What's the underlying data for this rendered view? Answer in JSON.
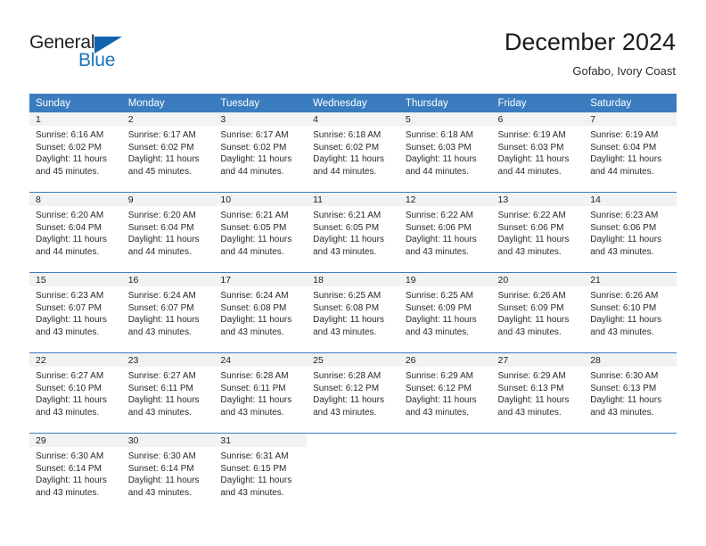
{
  "brand": {
    "name_part1": "General",
    "name_part2": "Blue",
    "triangle_icon": "triangle-icon",
    "color_dark": "#231f20",
    "color_blue": "#1b75bb"
  },
  "header": {
    "title": "December 2024",
    "subtitle": "Gofabo, Ivory Coast",
    "accent_color": "#3a7cbe",
    "daynum_band_color": "#f2f2f2"
  },
  "weekday_headers": [
    "Sunday",
    "Monday",
    "Tuesday",
    "Wednesday",
    "Thursday",
    "Friday",
    "Saturday"
  ],
  "weeks": [
    [
      {
        "day": "1",
        "sunrise": "Sunrise: 6:16 AM",
        "sunset": "Sunset: 6:02 PM",
        "daylight1": "Daylight: 11 hours",
        "daylight2": "and 45 minutes."
      },
      {
        "day": "2",
        "sunrise": "Sunrise: 6:17 AM",
        "sunset": "Sunset: 6:02 PM",
        "daylight1": "Daylight: 11 hours",
        "daylight2": "and 45 minutes."
      },
      {
        "day": "3",
        "sunrise": "Sunrise: 6:17 AM",
        "sunset": "Sunset: 6:02 PM",
        "daylight1": "Daylight: 11 hours",
        "daylight2": "and 44 minutes."
      },
      {
        "day": "4",
        "sunrise": "Sunrise: 6:18 AM",
        "sunset": "Sunset: 6:02 PM",
        "daylight1": "Daylight: 11 hours",
        "daylight2": "and 44 minutes."
      },
      {
        "day": "5",
        "sunrise": "Sunrise: 6:18 AM",
        "sunset": "Sunset: 6:03 PM",
        "daylight1": "Daylight: 11 hours",
        "daylight2": "and 44 minutes."
      },
      {
        "day": "6",
        "sunrise": "Sunrise: 6:19 AM",
        "sunset": "Sunset: 6:03 PM",
        "daylight1": "Daylight: 11 hours",
        "daylight2": "and 44 minutes."
      },
      {
        "day": "7",
        "sunrise": "Sunrise: 6:19 AM",
        "sunset": "Sunset: 6:04 PM",
        "daylight1": "Daylight: 11 hours",
        "daylight2": "and 44 minutes."
      }
    ],
    [
      {
        "day": "8",
        "sunrise": "Sunrise: 6:20 AM",
        "sunset": "Sunset: 6:04 PM",
        "daylight1": "Daylight: 11 hours",
        "daylight2": "and 44 minutes."
      },
      {
        "day": "9",
        "sunrise": "Sunrise: 6:20 AM",
        "sunset": "Sunset: 6:04 PM",
        "daylight1": "Daylight: 11 hours",
        "daylight2": "and 44 minutes."
      },
      {
        "day": "10",
        "sunrise": "Sunrise: 6:21 AM",
        "sunset": "Sunset: 6:05 PM",
        "daylight1": "Daylight: 11 hours",
        "daylight2": "and 44 minutes."
      },
      {
        "day": "11",
        "sunrise": "Sunrise: 6:21 AM",
        "sunset": "Sunset: 6:05 PM",
        "daylight1": "Daylight: 11 hours",
        "daylight2": "and 43 minutes."
      },
      {
        "day": "12",
        "sunrise": "Sunrise: 6:22 AM",
        "sunset": "Sunset: 6:06 PM",
        "daylight1": "Daylight: 11 hours",
        "daylight2": "and 43 minutes."
      },
      {
        "day": "13",
        "sunrise": "Sunrise: 6:22 AM",
        "sunset": "Sunset: 6:06 PM",
        "daylight1": "Daylight: 11 hours",
        "daylight2": "and 43 minutes."
      },
      {
        "day": "14",
        "sunrise": "Sunrise: 6:23 AM",
        "sunset": "Sunset: 6:06 PM",
        "daylight1": "Daylight: 11 hours",
        "daylight2": "and 43 minutes."
      }
    ],
    [
      {
        "day": "15",
        "sunrise": "Sunrise: 6:23 AM",
        "sunset": "Sunset: 6:07 PM",
        "daylight1": "Daylight: 11 hours",
        "daylight2": "and 43 minutes."
      },
      {
        "day": "16",
        "sunrise": "Sunrise: 6:24 AM",
        "sunset": "Sunset: 6:07 PM",
        "daylight1": "Daylight: 11 hours",
        "daylight2": "and 43 minutes."
      },
      {
        "day": "17",
        "sunrise": "Sunrise: 6:24 AM",
        "sunset": "Sunset: 6:08 PM",
        "daylight1": "Daylight: 11 hours",
        "daylight2": "and 43 minutes."
      },
      {
        "day": "18",
        "sunrise": "Sunrise: 6:25 AM",
        "sunset": "Sunset: 6:08 PM",
        "daylight1": "Daylight: 11 hours",
        "daylight2": "and 43 minutes."
      },
      {
        "day": "19",
        "sunrise": "Sunrise: 6:25 AM",
        "sunset": "Sunset: 6:09 PM",
        "daylight1": "Daylight: 11 hours",
        "daylight2": "and 43 minutes."
      },
      {
        "day": "20",
        "sunrise": "Sunrise: 6:26 AM",
        "sunset": "Sunset: 6:09 PM",
        "daylight1": "Daylight: 11 hours",
        "daylight2": "and 43 minutes."
      },
      {
        "day": "21",
        "sunrise": "Sunrise: 6:26 AM",
        "sunset": "Sunset: 6:10 PM",
        "daylight1": "Daylight: 11 hours",
        "daylight2": "and 43 minutes."
      }
    ],
    [
      {
        "day": "22",
        "sunrise": "Sunrise: 6:27 AM",
        "sunset": "Sunset: 6:10 PM",
        "daylight1": "Daylight: 11 hours",
        "daylight2": "and 43 minutes."
      },
      {
        "day": "23",
        "sunrise": "Sunrise: 6:27 AM",
        "sunset": "Sunset: 6:11 PM",
        "daylight1": "Daylight: 11 hours",
        "daylight2": "and 43 minutes."
      },
      {
        "day": "24",
        "sunrise": "Sunrise: 6:28 AM",
        "sunset": "Sunset: 6:11 PM",
        "daylight1": "Daylight: 11 hours",
        "daylight2": "and 43 minutes."
      },
      {
        "day": "25",
        "sunrise": "Sunrise: 6:28 AM",
        "sunset": "Sunset: 6:12 PM",
        "daylight1": "Daylight: 11 hours",
        "daylight2": "and 43 minutes."
      },
      {
        "day": "26",
        "sunrise": "Sunrise: 6:29 AM",
        "sunset": "Sunset: 6:12 PM",
        "daylight1": "Daylight: 11 hours",
        "daylight2": "and 43 minutes."
      },
      {
        "day": "27",
        "sunrise": "Sunrise: 6:29 AM",
        "sunset": "Sunset: 6:13 PM",
        "daylight1": "Daylight: 11 hours",
        "daylight2": "and 43 minutes."
      },
      {
        "day": "28",
        "sunrise": "Sunrise: 6:30 AM",
        "sunset": "Sunset: 6:13 PM",
        "daylight1": "Daylight: 11 hours",
        "daylight2": "and 43 minutes."
      }
    ],
    [
      {
        "day": "29",
        "sunrise": "Sunrise: 6:30 AM",
        "sunset": "Sunset: 6:14 PM",
        "daylight1": "Daylight: 11 hours",
        "daylight2": "and 43 minutes."
      },
      {
        "day": "30",
        "sunrise": "Sunrise: 6:30 AM",
        "sunset": "Sunset: 6:14 PM",
        "daylight1": "Daylight: 11 hours",
        "daylight2": "and 43 minutes."
      },
      {
        "day": "31",
        "sunrise": "Sunrise: 6:31 AM",
        "sunset": "Sunset: 6:15 PM",
        "daylight1": "Daylight: 11 hours",
        "daylight2": "and 43 minutes."
      },
      {
        "day": "",
        "sunrise": "",
        "sunset": "",
        "daylight1": "",
        "daylight2": ""
      },
      {
        "day": "",
        "sunrise": "",
        "sunset": "",
        "daylight1": "",
        "daylight2": ""
      },
      {
        "day": "",
        "sunrise": "",
        "sunset": "",
        "daylight1": "",
        "daylight2": ""
      },
      {
        "day": "",
        "sunrise": "",
        "sunset": "",
        "daylight1": "",
        "daylight2": ""
      }
    ]
  ]
}
